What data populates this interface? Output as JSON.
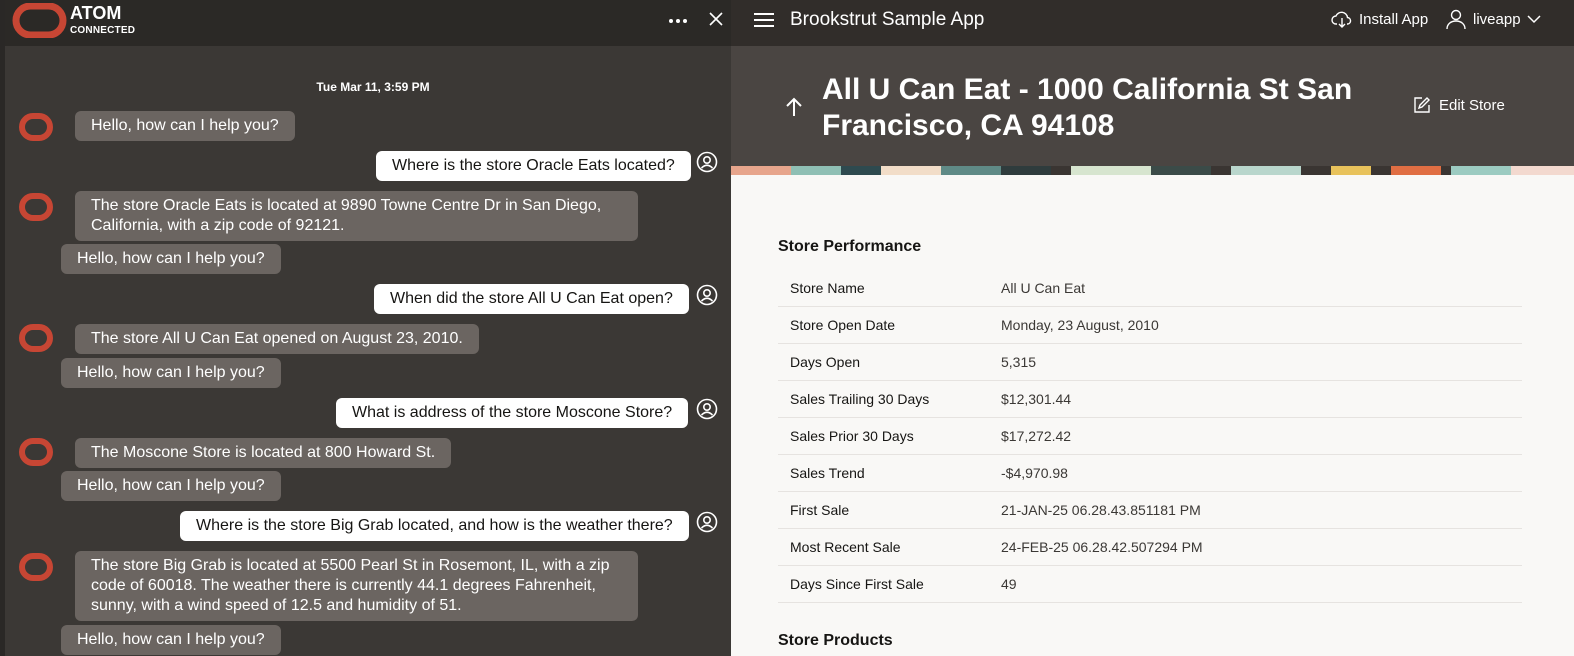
{
  "chat": {
    "title": "ATOM",
    "status": "CONNECTED",
    "date": "Tue Mar 11, 3:59 PM",
    "messages": [
      {
        "from": "bot",
        "text": "Hello, how can I help you?"
      },
      {
        "from": "user",
        "text": "Where is the store Oracle Eats located?"
      },
      {
        "from": "bot",
        "text": "The store Oracle Eats is located at 9890 Towne Centre Dr in San Diego, California, with a zip code of 92121."
      },
      {
        "from": "bot",
        "text": "Hello, how can I help you?"
      },
      {
        "from": "user",
        "text": "When did the store All U Can Eat open?"
      },
      {
        "from": "bot",
        "text": "The store All U Can Eat opened on August 23, 2010."
      },
      {
        "from": "bot",
        "text": "Hello, how can I help you?"
      },
      {
        "from": "user",
        "text": "What is address of the store Moscone Store?"
      },
      {
        "from": "bot",
        "text": "The Moscone Store is located at 800 Howard St."
      },
      {
        "from": "bot",
        "text": "Hello, how can I help you?"
      },
      {
        "from": "user",
        "text": "Where is the store Big Grab located, and how is the weather there?"
      },
      {
        "from": "bot",
        "text": "The store Big Grab is located at 5500 Pearl St in Rosemont, IL, with a zip code of 60018. The weather there is currently 44.1 degrees Fahrenheit, sunny, with a wind speed of 12.5 and humidity of 51."
      },
      {
        "from": "bot",
        "text": "Hello, how can I help you?"
      }
    ]
  },
  "app": {
    "name": "Brookstrut Sample App",
    "install_label": "Install App",
    "user_label": "liveapp",
    "page_title": "All U Can Eat - 1000 California St San Francisco, CA 94108",
    "edit_label": "Edit Store",
    "performance_title": "Store Performance",
    "performance": [
      {
        "label": "Store Name",
        "value": "All U Can Eat"
      },
      {
        "label": "Store Open Date",
        "value": "Monday, 23 August, 2010"
      },
      {
        "label": "Days Open",
        "value": "5,315"
      },
      {
        "label": "Sales Trailing 30 Days",
        "value": "$12,301.44"
      },
      {
        "label": "Sales Prior 30 Days",
        "value": "$17,272.42"
      },
      {
        "label": "Sales Trend",
        "value": "-$4,970.98"
      },
      {
        "label": "First Sale",
        "value": "21-JAN-25 06.28.43.851181 PM"
      },
      {
        "label": "Most Recent Sale",
        "value": "24-FEB-25 06.28.42.507294 PM"
      },
      {
        "label": "Days Since First Sale",
        "value": "49"
      }
    ],
    "products_title": "Store Products"
  },
  "colors": {
    "chat_bg": "#3b3835",
    "bot_bubble": "#6b6561",
    "user_bubble": "#ffffff",
    "brand_red": "#c74634",
    "app_header": "#312d2a"
  },
  "icons": [
    "atom-logo-icon",
    "more-icon",
    "close-icon",
    "user-avatar-icon",
    "hamburger-icon",
    "cloud-download-icon",
    "user-icon",
    "chevron-down-icon",
    "up-arrow-icon",
    "edit-icon"
  ]
}
